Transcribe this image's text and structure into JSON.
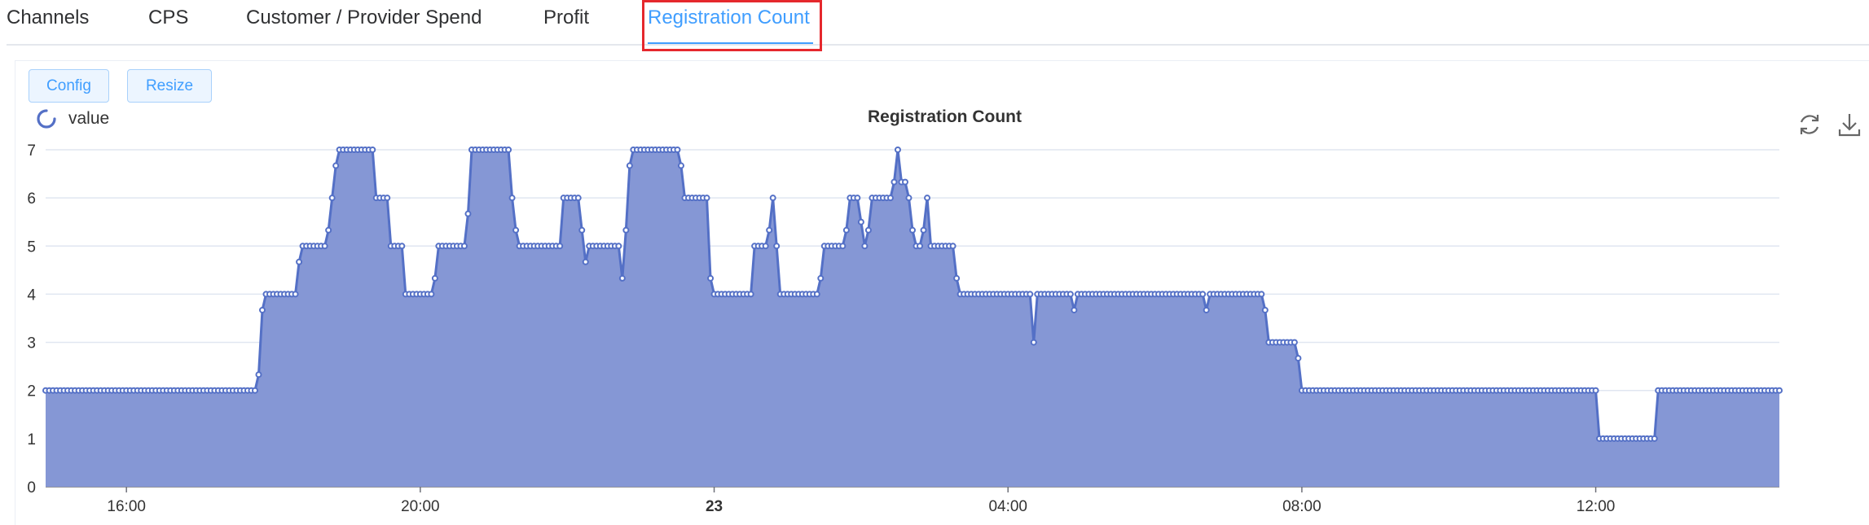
{
  "tabs": [
    {
      "label": "Channels"
    },
    {
      "label": "CPS"
    },
    {
      "label": "Customer / Provider Spend"
    },
    {
      "label": "Profit"
    },
    {
      "label": "Registration Count",
      "active": true
    }
  ],
  "toolbar": {
    "config_label": "Config",
    "resize_label": "Resize"
  },
  "colors": {
    "accent": "#409eff",
    "series": "#5470c6",
    "area": "#8597d5",
    "highlight": "#e5282d"
  },
  "chart_data": {
    "type": "area",
    "title": "Registration Count",
    "legend": {
      "entries": [
        "value"
      ],
      "position": "top-left"
    },
    "ylim": [
      0,
      7
    ],
    "yticks": [
      0,
      1,
      2,
      3,
      4,
      5,
      6,
      7
    ],
    "xticks": [
      "16:00",
      "20:00",
      "23",
      "04:00",
      "08:00",
      "12:00"
    ],
    "x_range_hours": [
      14.9,
      38.5
    ],
    "grid": true,
    "series": [
      {
        "name": "value",
        "points": [
          [
            14.9,
            2
          ],
          [
            17.75,
            2
          ],
          [
            17.8,
            2.33
          ],
          [
            17.85,
            3.67
          ],
          [
            17.9,
            4
          ],
          [
            18.3,
            4
          ],
          [
            18.35,
            4.67
          ],
          [
            18.4,
            5
          ],
          [
            18.7,
            5
          ],
          [
            18.75,
            5.33
          ],
          [
            18.8,
            6
          ],
          [
            18.85,
            6.67
          ],
          [
            18.9,
            7
          ],
          [
            19.35,
            7
          ],
          [
            19.4,
            6
          ],
          [
            19.55,
            6
          ],
          [
            19.6,
            5
          ],
          [
            19.75,
            5
          ],
          [
            19.8,
            4
          ],
          [
            20.15,
            4
          ],
          [
            20.2,
            4.33
          ],
          [
            20.25,
            5
          ],
          [
            20.6,
            5
          ],
          [
            20.65,
            5.67
          ],
          [
            20.7,
            7
          ],
          [
            21.2,
            7
          ],
          [
            21.25,
            6
          ],
          [
            21.3,
            5.33
          ],
          [
            21.35,
            5
          ],
          [
            21.9,
            5
          ],
          [
            21.95,
            6
          ],
          [
            22.15,
            6
          ],
          [
            22.2,
            5.33
          ],
          [
            22.25,
            4.67
          ],
          [
            22.3,
            5
          ],
          [
            22.7,
            5
          ],
          [
            22.75,
            4.33
          ],
          [
            22.8,
            5.33
          ],
          [
            22.85,
            6.67
          ],
          [
            22.9,
            7
          ],
          [
            23.5,
            7
          ],
          [
            23.55,
            6.67
          ],
          [
            23.6,
            6
          ],
          [
            23.9,
            6
          ],
          [
            23.95,
            4.33
          ],
          [
            24.0,
            4
          ],
          [
            24.5,
            4
          ],
          [
            24.55,
            5
          ],
          [
            24.7,
            5
          ],
          [
            24.75,
            5.33
          ],
          [
            24.8,
            6
          ],
          [
            24.85,
            5
          ],
          [
            24.9,
            4
          ],
          [
            25.4,
            4
          ],
          [
            25.45,
            4.33
          ],
          [
            25.5,
            5
          ],
          [
            25.75,
            5
          ],
          [
            25.8,
            5.33
          ],
          [
            25.85,
            6
          ],
          [
            25.95,
            6
          ],
          [
            26.0,
            5.5
          ],
          [
            26.05,
            5
          ],
          [
            26.1,
            5.33
          ],
          [
            26.15,
            6
          ],
          [
            26.4,
            6
          ],
          [
            26.45,
            6.33
          ],
          [
            26.5,
            7
          ],
          [
            26.55,
            6.33
          ],
          [
            26.6,
            6.33
          ],
          [
            26.65,
            6
          ],
          [
            26.7,
            5.33
          ],
          [
            26.75,
            5
          ],
          [
            26.8,
            5
          ],
          [
            26.85,
            5.33
          ],
          [
            26.9,
            6
          ],
          [
            26.95,
            5
          ],
          [
            27.25,
            5
          ],
          [
            27.3,
            4.33
          ],
          [
            27.35,
            4
          ],
          [
            28.3,
            4
          ],
          [
            28.35,
            3
          ],
          [
            28.4,
            4
          ],
          [
            28.85,
            4
          ],
          [
            28.9,
            3.67
          ],
          [
            28.95,
            4
          ],
          [
            30.65,
            4
          ],
          [
            30.7,
            3.67
          ],
          [
            30.75,
            4
          ],
          [
            31.45,
            4
          ],
          [
            31.5,
            3.67
          ],
          [
            31.55,
            3
          ],
          [
            31.9,
            3
          ],
          [
            31.95,
            2.67
          ],
          [
            32.0,
            2
          ],
          [
            36.0,
            2
          ],
          [
            36.05,
            1
          ],
          [
            36.8,
            1
          ],
          [
            36.85,
            2
          ],
          [
            38.5,
            2
          ]
        ]
      }
    ]
  }
}
